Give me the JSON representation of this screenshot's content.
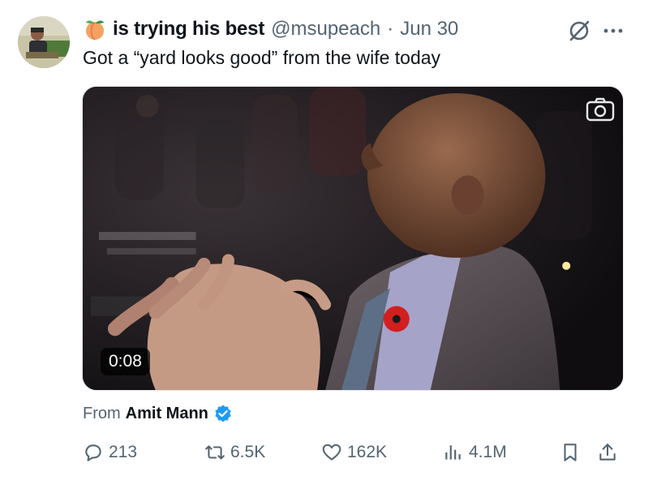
{
  "author": {
    "display_name": "is trying his best",
    "handle": "@msupeach",
    "separator": "·",
    "date": "Jun 30"
  },
  "tweet": {
    "text": "Got a “yard looks good” from the wife today"
  },
  "media": {
    "duration": "0:08"
  },
  "attribution": {
    "prefix": "From",
    "source": "Amit Mann"
  },
  "stats": {
    "replies": "213",
    "reposts": "6.5K",
    "likes": "162K",
    "views": "4.1M"
  },
  "colors": {
    "secondary_text": "#536471",
    "verified_blue": "#1d9bf0",
    "poppy_red": "#d21f1f"
  }
}
